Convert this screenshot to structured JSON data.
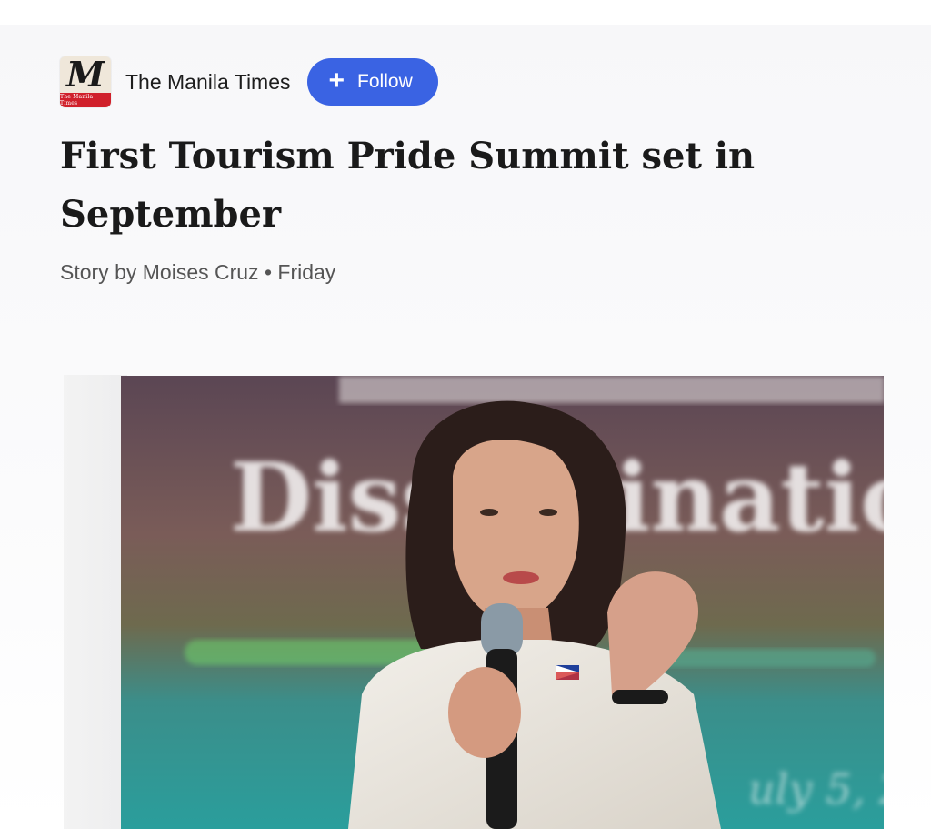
{
  "publisher": {
    "name": "The Manila Times",
    "logo_letter": "M",
    "logo_band_text": "The Manila Times",
    "follow_label": "Follow"
  },
  "article": {
    "headline": "First Tourism Pride Summit set in September",
    "byline": "Story by Moises Cruz • Friday"
  },
  "hero": {
    "backdrop_text": "Dissemination"
  },
  "colors": {
    "follow_button": "#3a63e3",
    "logo_band": "#d0202a"
  },
  "icons": {
    "follow": "plus-icon"
  }
}
